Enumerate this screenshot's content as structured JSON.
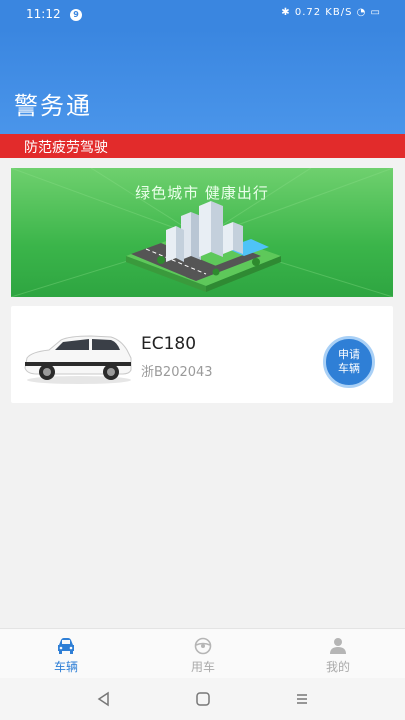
{
  "status": {
    "time": "11:12",
    "notification_count": "9",
    "right_info": "0.72 KB/S"
  },
  "header": {
    "title": "警务通"
  },
  "notice": {
    "text": "防范疲劳驾驶"
  },
  "banner": {
    "slogan": "绿色城市 健康出行"
  },
  "vehicle": {
    "model": "EC180",
    "plate": "浙B202043",
    "apply_label_1": "申请",
    "apply_label_2": "车辆"
  },
  "tabs": [
    {
      "label": "车辆",
      "active": true
    },
    {
      "label": "用车",
      "active": false
    },
    {
      "label": "我的",
      "active": false
    }
  ],
  "colors": {
    "primary": "#3a86e0",
    "alert": "#e22b2b",
    "active_tab": "#2f7fd6",
    "inactive_tab": "#aaaaaa"
  }
}
